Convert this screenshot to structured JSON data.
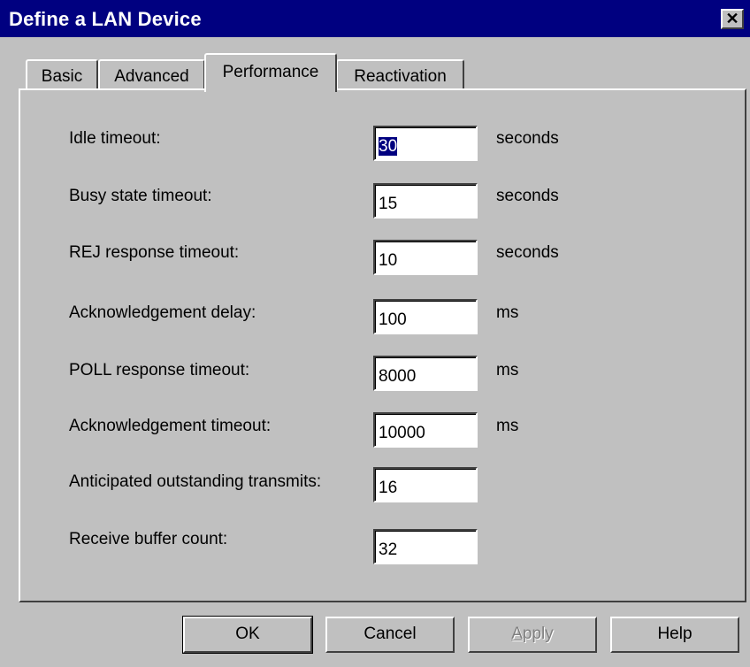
{
  "window": {
    "title": "Define a LAN Device",
    "close_icon": "close-icon",
    "close_glyph": "✕"
  },
  "tabs": [
    {
      "label": "Basic",
      "active": false
    },
    {
      "label": "Advanced",
      "active": false
    },
    {
      "label": "Performance",
      "active": true
    },
    {
      "label": "Reactivation",
      "active": false
    }
  ],
  "performance": {
    "fields": [
      {
        "label": "Idle timeout:",
        "value": "30",
        "unit": "seconds",
        "selected": true
      },
      {
        "label": "Busy state timeout:",
        "value": "15",
        "unit": "seconds"
      },
      {
        "label": "REJ response timeout:",
        "value": "10",
        "unit": "seconds"
      },
      {
        "label": "Acknowledgement delay:",
        "value": "100",
        "unit": "ms"
      },
      {
        "label": "POLL response timeout:",
        "value": "8000",
        "unit": "ms"
      },
      {
        "label": "Acknowledgement timeout:",
        "value": "10000",
        "unit": "ms"
      },
      {
        "label": "Anticipated outstanding transmits:",
        "value": "16",
        "unit": ""
      },
      {
        "label": "Receive buffer count:",
        "value": "32",
        "unit": ""
      }
    ]
  },
  "buttons": {
    "ok": "OK",
    "cancel": "Cancel",
    "apply_first": "A",
    "apply_rest": "pply",
    "help": "Help"
  },
  "colors": {
    "titlebar": "#000080",
    "face": "#c0c0c0",
    "selection": "#000080"
  }
}
